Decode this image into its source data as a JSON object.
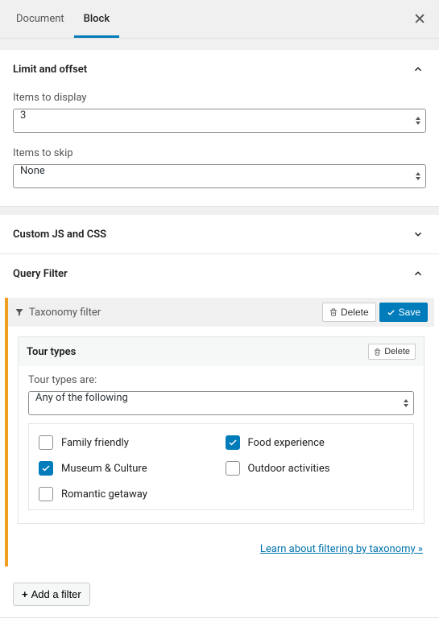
{
  "tabs": {
    "document": "Document",
    "block": "Block"
  },
  "panels": {
    "limitOffset": {
      "title": "Limit and offset",
      "itemsToDisplay": {
        "label": "Items to display",
        "value": "3"
      },
      "itemsToSkip": {
        "label": "Items to skip",
        "value": "None"
      }
    },
    "customJsCss": {
      "title": "Custom JS and CSS"
    },
    "queryFilter": {
      "title": "Query Filter",
      "card": {
        "headerTitle": "Taxonomy filter",
        "deleteLabel": "Delete",
        "saveLabel": "Save",
        "inner": {
          "title": "Tour types",
          "deleteLabel": "Delete",
          "subLabel": "Tour types are:",
          "selectValue": "Any of the following",
          "options": [
            {
              "label": "Family friendly",
              "checked": false
            },
            {
              "label": "Food experience",
              "checked": true
            },
            {
              "label": "Museum & Culture",
              "checked": true
            },
            {
              "label": "Outdoor activities",
              "checked": false
            },
            {
              "label": "Romantic getaway",
              "checked": false
            }
          ]
        },
        "learnLink": "Learn about filtering by taxonomy »"
      },
      "addFilterLabel": "Add a filter"
    }
  }
}
